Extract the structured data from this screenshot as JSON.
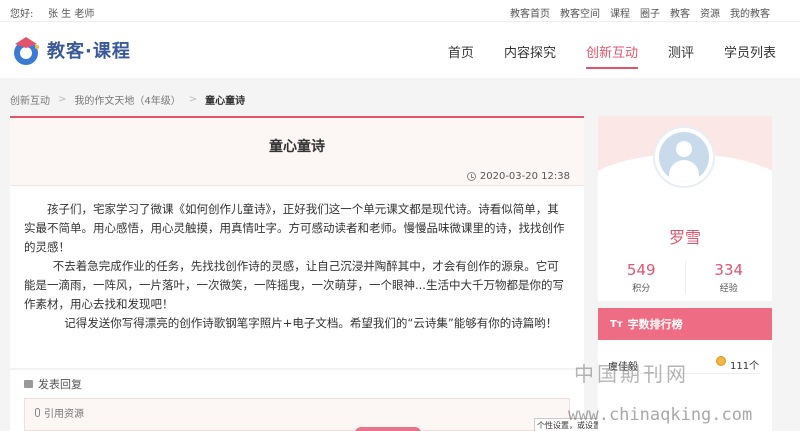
{
  "topbar": {
    "greeting": "您好:",
    "user": "张 生 老师",
    "links": [
      "教客首页",
      "教客空间",
      "课程",
      "圈子",
      "教客",
      "资源",
      "我的教客"
    ]
  },
  "header": {
    "logo_text": "教客·课程",
    "nav": [
      "首页",
      "内容探究",
      "创新互动",
      "测评",
      "学员列表"
    ],
    "active_nav": "创新互动"
  },
  "breadcrumb": [
    "创新互动",
    "我的作文天地（4年级）",
    "童心童诗"
  ],
  "article": {
    "title": "童心童诗",
    "date": "2020-03-20 12:38",
    "paragraphs": [
      "孩子们，宅家学习了微课《如何创作儿童诗》，正好我们这一个单元课文都是现代诗。诗看似简单，其实最不简单。用心感悟，用心灵触摸，用真情吐字。方可感动读者和老师。慢慢品味微课里的诗，找找创作的灵感！",
      "不去着急完成作业的任务，先找找创作诗的灵感，让自己沉浸并陶醉其中，才会有创作的源泉。它可能是一滴雨，一阵风，一片落叶，一次微笑，一阵摇曳，一次萌芽，一个眼神...生活中大千万物都是你的写作素材，用心去找和发现吧！",
      "记得发送你写得漂亮的创作诗歌钢笔字照片+电子文档。希望我们的“云诗集”能够有你的诗篇哟！"
    ]
  },
  "comment": {
    "title": "发表回复",
    "cite_label": "引用资源",
    "settings_note": "个性设置，或设置其"
  },
  "profile": {
    "name": "罗雪",
    "points_value": "549",
    "points_label": "积分",
    "exp_value": "334",
    "exp_label": "经验"
  },
  "ranking": {
    "title": "字数排行榜",
    "rows": [
      {
        "name": "虞佳毅",
        "count": "111个"
      }
    ]
  },
  "watermark": {
    "cn": "中国期刊网",
    "url": "www.chinaqking.com"
  },
  "colors": {
    "accent": "#e0556b",
    "rank_header": "#ef6d84",
    "logo_blue": "#3b5998"
  }
}
